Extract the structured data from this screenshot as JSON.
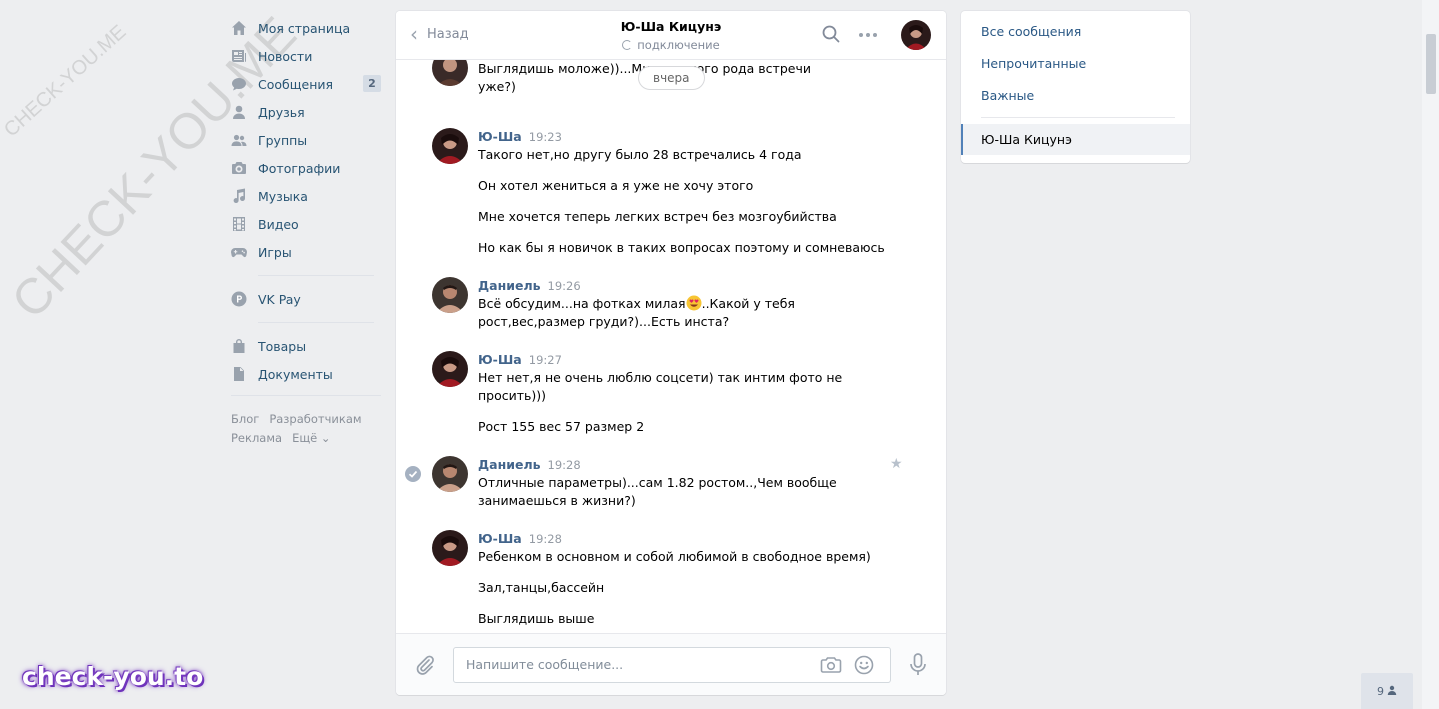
{
  "watermark": {
    "small": "CHECK-YOU.ME",
    "big": "CHECK-YOU.ME",
    "brand": "check-you.to"
  },
  "nav": {
    "items": [
      {
        "label": "Моя страница",
        "icon": "home-icon"
      },
      {
        "label": "Новости",
        "icon": "news-icon"
      },
      {
        "label": "Сообщения",
        "icon": "messages-icon",
        "badge": "2"
      },
      {
        "label": "Друзья",
        "icon": "friend-icon"
      },
      {
        "label": "Группы",
        "icon": "groups-icon"
      },
      {
        "label": "Фотографии",
        "icon": "camera-icon"
      },
      {
        "label": "Музыка",
        "icon": "music-icon"
      },
      {
        "label": "Видео",
        "icon": "video-icon"
      },
      {
        "label": "Игры",
        "icon": "gamepad-icon"
      }
    ],
    "vkpay": "VK Pay",
    "items2": [
      {
        "label": "Товары",
        "icon": "bag-icon"
      },
      {
        "label": "Документы",
        "icon": "document-icon"
      }
    ],
    "footer": {
      "blog": "Блог",
      "dev": "Разработчикам",
      "ads": "Реклама",
      "more": "Ещё ⌄"
    }
  },
  "chat": {
    "back": "Назад",
    "title": "Ю-Ша Кицунэ",
    "status": "подключение",
    "date_divider": "вчера",
    "messages": [
      {
        "author": "",
        "time": "",
        "lines": [
          "Выглядишь моложе))...Мне          и такого рода встречи",
          "уже?)"
        ]
      },
      {
        "author": "Ю-Ша",
        "time": "19:23",
        "paragraphs": [
          [
            "Такого нет,но другу было 28 встречались 4 года"
          ],
          [
            "Он хотел жениться а я уже не хочу этого"
          ],
          [
            "Мне хочется теперь легких встреч без мозгоубийства"
          ],
          [
            "Но как бы я новичок в таких вопросах поэтому и сомневаюсь"
          ]
        ]
      },
      {
        "author": "Даниель",
        "time": "19:26",
        "paragraphs": [
          [
            "Всё обсудим...на фотках милая",
            "рост,вес,размер груди?)...Есть инста?"
          ]
        ],
        "after_emoji": "..Какой у тебя"
      },
      {
        "author": "Ю-Ша",
        "time": "19:27",
        "paragraphs": [
          [
            "Нет нет,я не очень люблю соцсети) так интим фото не",
            "просить)))"
          ],
          [
            "Рост 155 вес 57 размер 2"
          ]
        ]
      },
      {
        "author": "Даниель",
        "time": "19:28",
        "paragraphs": [
          [
            "Отличные параметры)...сам 1.82 ростом..,Чем вообще",
            "занимаешься в жизни?)"
          ]
        ]
      },
      {
        "author": "Ю-Ша",
        "time": "19:28",
        "paragraphs": [
          [
            "Ребенком в основном и собой любимой в свободное время)"
          ],
          [
            "Зал,танцы,бассейн"
          ],
          [
            "Выглядишь выше"
          ]
        ]
      }
    ],
    "composer_placeholder": "Напишите сообщение..."
  },
  "right_panel": {
    "all": "Все сообщения",
    "unread": "Непрочитанные",
    "important": "Важные",
    "active_chat": "Ю-Ша Кицунэ"
  },
  "online_count": "9",
  "colors": {
    "link": "#2a5885",
    "author": "#42648b",
    "bg": "#edeef0",
    "accent": "#5181b8"
  }
}
